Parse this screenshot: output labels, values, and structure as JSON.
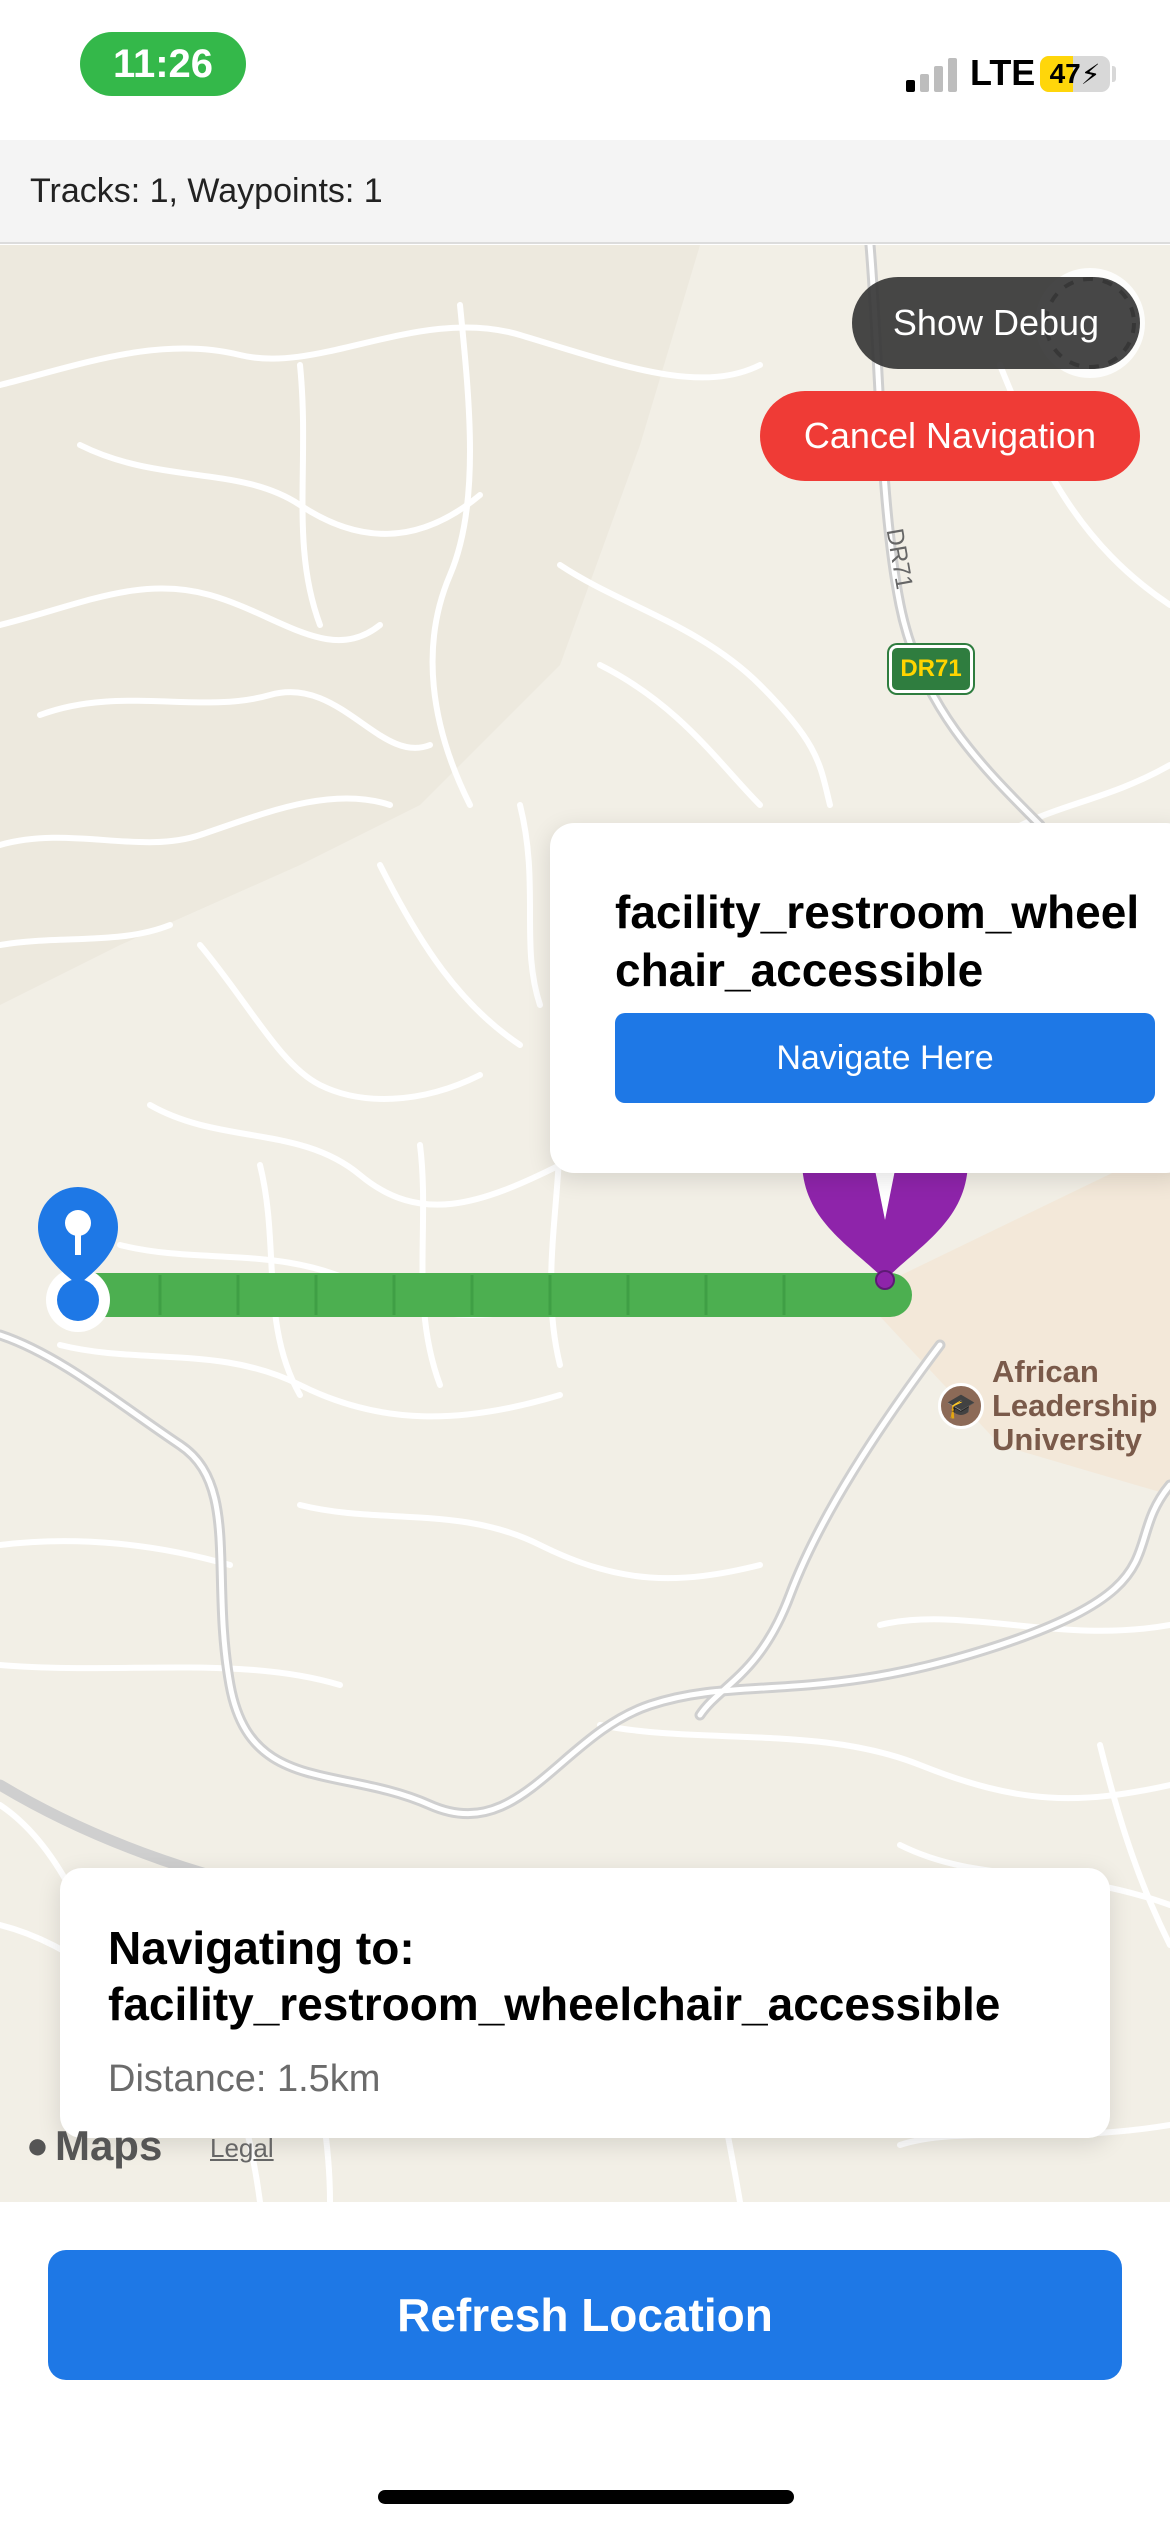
{
  "status_bar": {
    "time": "11:26",
    "network": "LTE",
    "battery_level": "47",
    "signal_bars_active": 1,
    "signal_bars_total": 4,
    "battery_fraction": 0.47,
    "time_pill_color": "#34b84a",
    "battery_color": "#ffd60a"
  },
  "info_bar": {
    "text": "Tracks: 1, Waypoints: 1"
  },
  "map": {
    "show_debug_label": "Show Debug",
    "cancel_navigation_label": "Cancel Navigation",
    "route_badge": "DR71",
    "road_label": "DR71",
    "poi_popup": {
      "title": "facility_restroom_wheelchair_accessible",
      "navigate_label": "Navigate Here"
    },
    "poi": {
      "label_line1": "African",
      "label_line2": "Leadership",
      "label_line3": "University",
      "icon": "graduation-cap-icon"
    },
    "attribution": {
      "maps_label": "Maps",
      "legal_label": "Legal"
    },
    "colors": {
      "route": "#4caf50",
      "start_pin": "#1e78e6",
      "destination_pin": "#8e24aa",
      "cancel": "#ef3b36"
    }
  },
  "navigation_card": {
    "title_line1": "Navigating to:",
    "title_line2": "facility_restroom_wheelchair_accessible",
    "distance": "Distance: 1.5km"
  },
  "bottom": {
    "refresh_label": "Refresh Location"
  }
}
